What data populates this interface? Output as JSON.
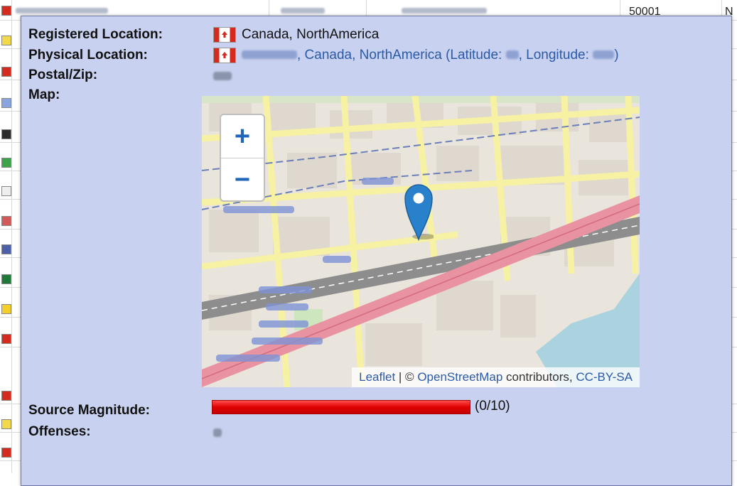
{
  "background": {
    "top_row_port": "50001",
    "top_row_col": "N"
  },
  "popup": {
    "registered_label": "Registered Location:",
    "registered_value": "Canada, NorthAmerica",
    "physical_label": "Physical Location:",
    "physical_prefix": ", Canada, NorthAmerica (Latitude: ",
    "physical_mid": ", Longitude: ",
    "physical_suffix": ")",
    "postal_label": "Postal/Zip:",
    "map_label": "Map:",
    "magnitude_label": "Source Magnitude:",
    "magnitude_value": "(0/10)",
    "magnitude_fraction": 0.0,
    "offenses_label": "Offenses:"
  },
  "map": {
    "zoom_in": "+",
    "zoom_out": "−",
    "attr_leaflet": "Leaflet",
    "attr_sep1": " | © ",
    "attr_osm": "OpenStreetMap",
    "attr_mid": " contributors, ",
    "attr_cc": "CC-BY-SA"
  },
  "colors": {
    "popup_bg": "#c8d1ef",
    "link": "#2b5aa8",
    "magnitude_bar": "#e00000",
    "marker": "#2a81cb"
  }
}
